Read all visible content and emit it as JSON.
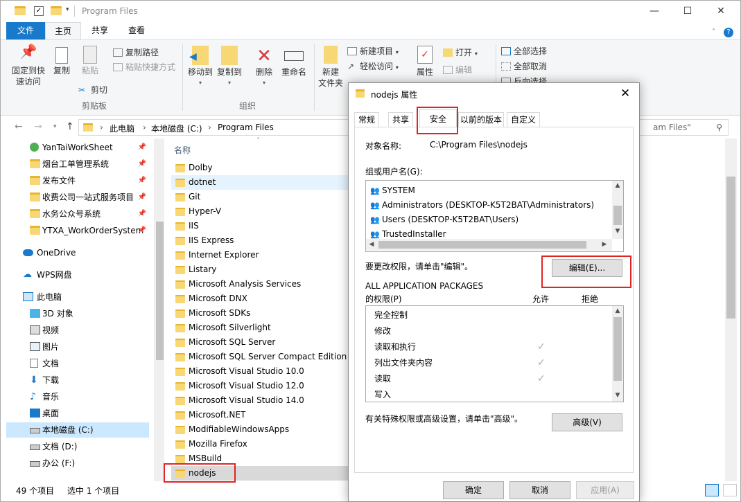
{
  "explorer": {
    "title": "Program Files",
    "ribbon_tabs": [
      "文件",
      "主页",
      "共享",
      "查看"
    ],
    "ribbon": {
      "pin_quick_access": "固定到快\n速访问",
      "copy": "复制",
      "paste": "粘贴",
      "copy_path": "复制路径",
      "paste_shortcut": "粘贴快捷方式",
      "cut": "剪切",
      "clipboard_group": "剪贴板",
      "move_to": "移动到",
      "copy_to": "复制到",
      "delete": "删除",
      "rename": "重命名",
      "organize_group": "组织",
      "new_folder": "新建\n文件夹",
      "new_item": "新建项目",
      "easy_access": "轻松访问",
      "properties": "属性",
      "open": "打开",
      "edit": "编辑",
      "select_all": "全部选择",
      "select_none": "全部取消",
      "invert_selection": "反向选择"
    },
    "address": {
      "crumbs": [
        "此电脑",
        "本地磁盘 (C:)",
        "Program Files"
      ],
      "search_placeholder": "am Files\""
    },
    "nav_pane": [
      {
        "label": "YanTaiWorkSheet",
        "pinned": true
      },
      {
        "label": "烟台工单管理系统",
        "pinned": true
      },
      {
        "label": "发布文件",
        "pinned": true
      },
      {
        "label": "收费公司一站式服务项目",
        "pinned": true
      },
      {
        "label": "水务公众号系统",
        "pinned": true
      },
      {
        "label": "YTXA_WorkOrderSystem",
        "pinned": true
      },
      {
        "label": "OneDrive"
      },
      {
        "label": "WPS网盘"
      },
      {
        "label": "此电脑"
      },
      {
        "label": "3D 对象"
      },
      {
        "label": "视频"
      },
      {
        "label": "图片"
      },
      {
        "label": "文档"
      },
      {
        "label": "下载"
      },
      {
        "label": "音乐"
      },
      {
        "label": "桌面"
      },
      {
        "label": "本地磁盘 (C:)"
      },
      {
        "label": "文档 (D:)"
      },
      {
        "label": "办公 (F:)"
      }
    ],
    "column_name": "名称",
    "files": [
      "Dolby",
      "dotnet",
      "Git",
      "Hyper-V",
      "IIS",
      "IIS Express",
      "Internet Explorer",
      "Listary",
      "Microsoft Analysis Services",
      "Microsoft DNX",
      "Microsoft SDKs",
      "Microsoft Silverlight",
      "Microsoft SQL Server",
      "Microsoft SQL Server Compact Edition",
      "Microsoft Visual Studio 10.0",
      "Microsoft Visual Studio 12.0",
      "Microsoft Visual Studio 14.0",
      "Microsoft.NET",
      "ModifiableWindowsApps",
      "Mozilla Firefox",
      "MSBuild",
      "nodejs"
    ],
    "status": {
      "count": "49 个项目",
      "selected": "选中 1 个项目"
    }
  },
  "dialog": {
    "title": "nodejs 属性",
    "tabs": [
      "常规",
      "共享",
      "安全",
      "以前的版本",
      "自定义"
    ],
    "object_name_label": "对象名称:",
    "object_name_value": "C:\\Program Files\\nodejs",
    "groups_label": "组或用户名(G):",
    "users": [
      "SYSTEM",
      "Administrators (DESKTOP-K5T2BAT\\Administrators)",
      "Users (DESKTOP-K5T2BAT\\Users)",
      "TrustedInstaller"
    ],
    "change_hint": "要更改权限，请单击\"编辑\"。",
    "edit_button": "编辑(E)...",
    "perm_for_line1": "ALL APPLICATION PACKAGES",
    "perm_for_line2": "的权限(P)",
    "allow": "允许",
    "deny": "拒绝",
    "permissions": [
      {
        "name": "完全控制",
        "allow": false
      },
      {
        "name": "修改",
        "allow": false
      },
      {
        "name": "读取和执行",
        "allow": true
      },
      {
        "name": "列出文件夹内容",
        "allow": true
      },
      {
        "name": "读取",
        "allow": true
      },
      {
        "name": "写入",
        "allow": false
      }
    ],
    "advanced_hint": "有关特殊权限或高级设置，请单击\"高级\"。",
    "advanced_button": "高级(V)",
    "ok": "确定",
    "cancel": "取消",
    "apply": "应用(A)"
  },
  "colors": {
    "accent": "#1979ca",
    "highlight": "#e02424",
    "selected_row": "#d9d9d9"
  }
}
